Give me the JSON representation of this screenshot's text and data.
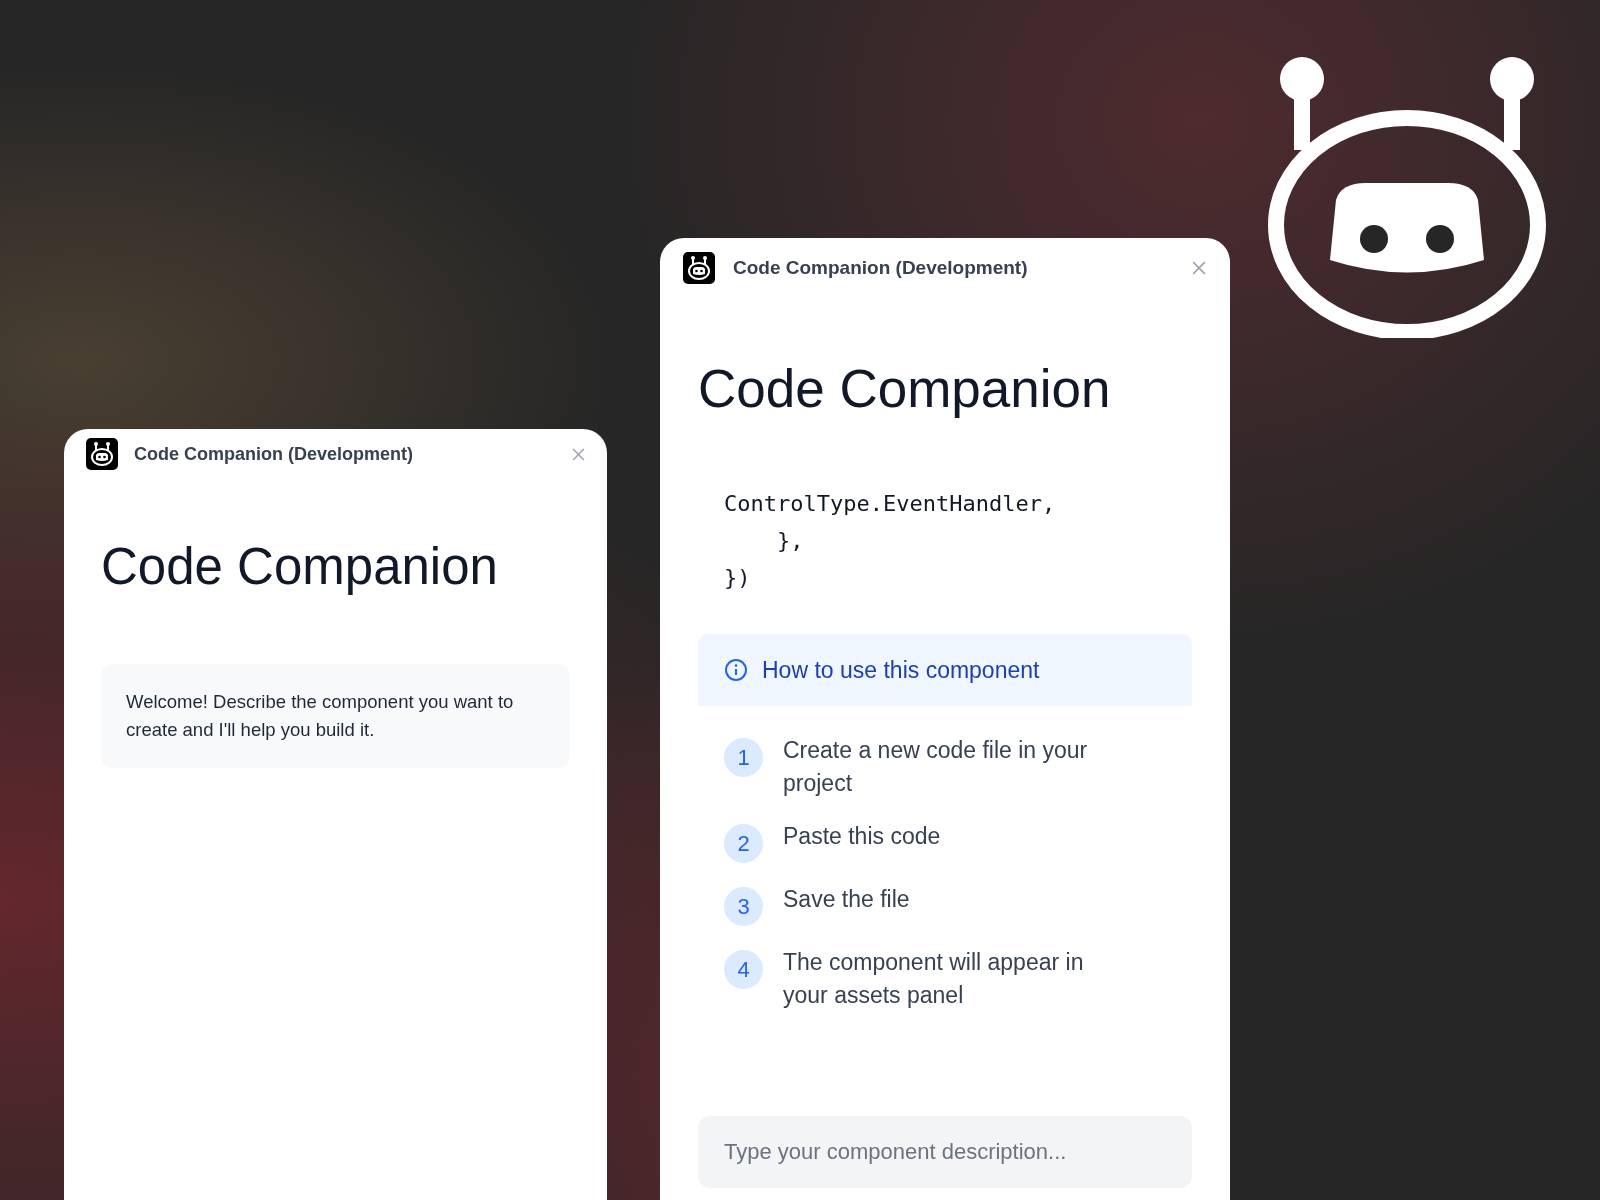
{
  "windows": [
    {
      "title": "Code Companion (Development)",
      "heading": "Code Companion",
      "welcome": "Welcome! Describe the component you want to create and I'll help you build it."
    },
    {
      "title": "Code Companion (Development)",
      "heading": "Code Companion",
      "code_lines": [
        "ControlType.EventHandler,",
        "    },",
        "})"
      ],
      "info_title": "How to use this component",
      "steps": [
        {
          "number": "1",
          "text": "Create a new code file in your project"
        },
        {
          "number": "2",
          "text": "Paste this code"
        },
        {
          "number": "3",
          "text": "Save the file"
        },
        {
          "number": "4",
          "text": "The component will appear in your assets panel"
        }
      ],
      "input": {
        "placeholder": "Type your component description..."
      }
    }
  ]
}
